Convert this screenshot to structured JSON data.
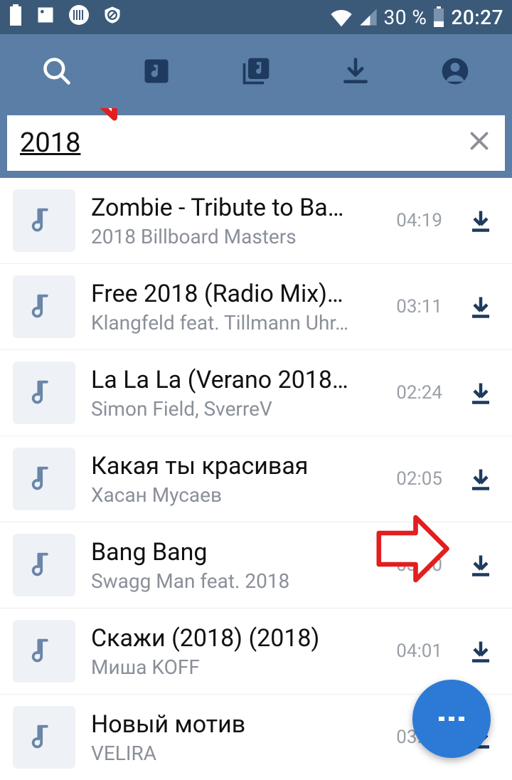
{
  "status": {
    "battery_percent": "30 %",
    "time": "20:27"
  },
  "search": {
    "query": "2018"
  },
  "tracks": [
    {
      "title": "Zombie - Tribute to Ba…",
      "artist": "2018 Billboard Masters",
      "duration": "04:19"
    },
    {
      "title": "Free 2018 (Radio Mix)…",
      "artist": "Klangfeld feat. Tillmann Uhr…",
      "duration": "03:11"
    },
    {
      "title": "La La La (Verano 2018…",
      "artist": "Simon Field, SverreV",
      "duration": "02:24"
    },
    {
      "title": "Какая ты красивая",
      "artist": "Хасан Мусаев",
      "duration": "02:05"
    },
    {
      "title": "Bang Bang",
      "artist": "Swagg Man feat. 2018",
      "duration": "03:40"
    },
    {
      "title": "Скажи (2018) (2018)",
      "artist": "Миша KOFF",
      "duration": "04:01"
    },
    {
      "title": "Новый мотив",
      "artist": "VELIRA",
      "duration": "03:37"
    }
  ]
}
